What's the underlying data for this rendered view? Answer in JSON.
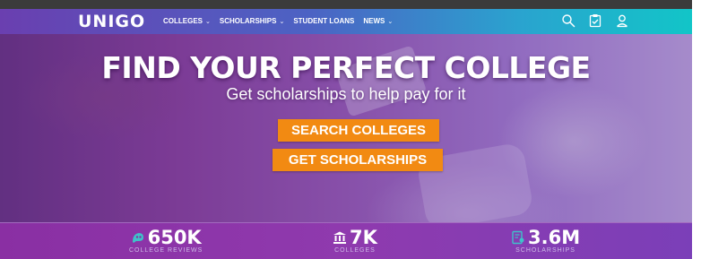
{
  "nav": {
    "logo": "UNIGO",
    "menu": [
      {
        "label": "COLLEGES",
        "has_dropdown": true
      },
      {
        "label": "SCHOLARSHIPS",
        "has_dropdown": true
      },
      {
        "label": "STUDENT LOANS",
        "has_dropdown": false
      },
      {
        "label": "NEWS",
        "has_dropdown": true
      }
    ],
    "icons": [
      "search-icon",
      "clipboard-check-icon",
      "user-icon"
    ]
  },
  "hero": {
    "headline": "FIND YOUR PERFECT COLLEGE",
    "subhead": "Get scholarships to help pay for it",
    "buttons": {
      "search": "SEARCH COLLEGES",
      "scholarships": "GET SCHOLARSHIPS"
    }
  },
  "stats": [
    {
      "value": "650K",
      "label": "COLLEGE REVIEWS",
      "icon": "reviews-icon"
    },
    {
      "value": "7K",
      "label": "COLLEGES",
      "icon": "building-icon"
    },
    {
      "value": "3.6M",
      "label": "SCHOLARSHIPS",
      "icon": "certificate-icon"
    }
  ],
  "colors": {
    "accent_orange": "#f28a12",
    "stats_purple": "#8a2fa3",
    "nav_gradient_start": "#6a3fb0",
    "nav_gradient_end": "#12c5c8"
  }
}
